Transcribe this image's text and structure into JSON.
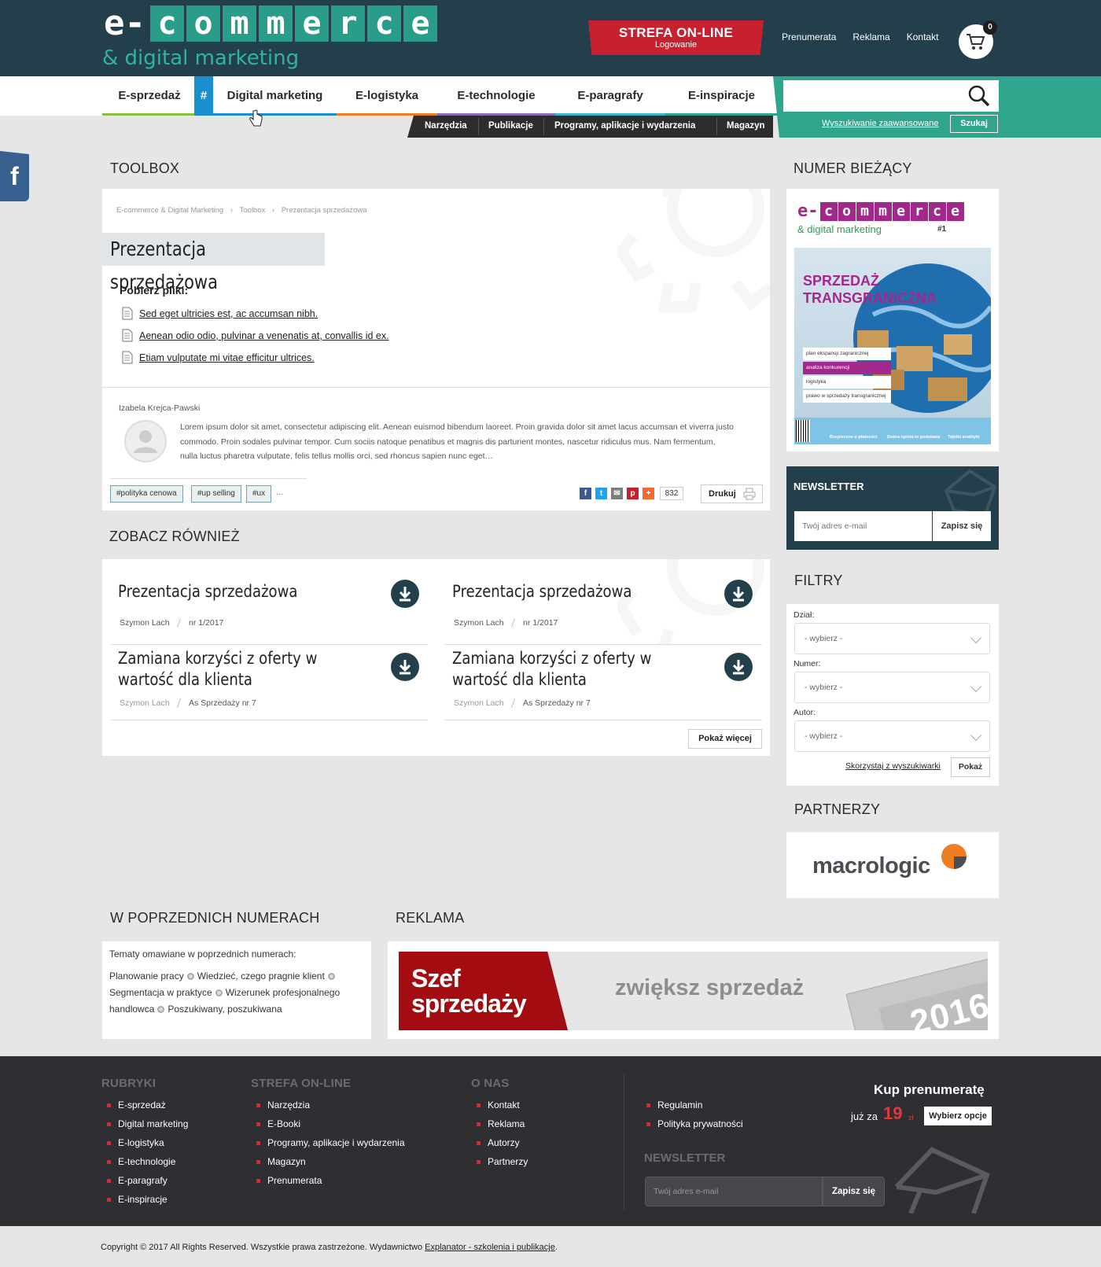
{
  "header": {
    "logo_main_plain": "e-",
    "logo_main_tiles": [
      "c",
      "o",
      "m",
      "m",
      "e",
      "r",
      "c",
      "e"
    ],
    "logo_sub": "& digital marketing",
    "strefa_title": "STREFA ON-LINE",
    "strefa_sub": "Logowanie",
    "links": [
      "Prenumerata",
      "Reklama",
      "Kontakt"
    ],
    "cart_count": "0"
  },
  "nav": {
    "items": [
      {
        "label": "E-sprzedaż",
        "color": "#8cbf3f"
      },
      {
        "label": "Digital marketing",
        "color": "#1a8fcf"
      },
      {
        "label": "E-logistyka",
        "color": "#ef7d22"
      },
      {
        "label": "E-technologie",
        "color": "#8b6bb1"
      },
      {
        "label": "E-paragrafy",
        "color": "#3db7c6"
      },
      {
        "label": "E-inspiracje",
        "color": "#2fa58e"
      }
    ],
    "hash": "#",
    "sub": [
      "Narzędzia",
      "Publikacje",
      "Programy, aplikacje i wydarzenia",
      "Magazyn"
    ]
  },
  "search": {
    "placeholder": "",
    "advanced": "Wyszukiwanie zaawansowane",
    "button": "Szukaj"
  },
  "social_tab": "f",
  "toolbox": {
    "section_title": "TOOLBOX",
    "breadcrumb": [
      "E-commerce & Digital Marketing",
      "›",
      "Toolbox",
      "›",
      "Prezentacja sprzedażowa"
    ],
    "title": "Prezentacja sprzedażowa",
    "download_heading": "Pobierz pliki:",
    "files": [
      "Sed eget ultricies est, ac accumsan nibh.",
      "Aenean odio odio, pulvinar a venenatis at, convallis id ex.",
      "Etiam vulputate mi vitae efficitur ultrices."
    ],
    "author": "Izabela Krejca-Pawski",
    "bio": "Lorem ipsum dolor sit amet, consectetur adipiscing elit. Aenean euismod bibendum laoreet. Proin gravida dolor sit amet lacus accumsan et viverra justo commodo. Proin sodales pulvinar tempor. Cum sociis natoque penatibus et magnis dis parturient montes, nascetur ridiculus mus. Nam fermentum, nulla luctus pharetra vulputate, felis tellus mollis orci, sed rhoncus sapien nunc eget…",
    "tags": [
      "#polityka cenowa",
      "#up selling",
      "#ux"
    ],
    "tags_more": "...",
    "share_count": "832",
    "print": "Drukuj"
  },
  "see_also": {
    "section_title": "ZOBACZ RÓWNIEŻ",
    "items": [
      {
        "title": "Prezentacja sprzedażowa",
        "author": "Szymon Lach",
        "issue": "nr 1/2017"
      },
      {
        "title": "Prezentacja sprzedażowa",
        "author": "Szymon Lach",
        "issue": "nr 1/2017"
      },
      {
        "title": "Zamiana korzyści z oferty w wartość dla klienta",
        "author": "Szymon Lach",
        "issue": "As Sprzedaży nr 7"
      },
      {
        "title": "Zamiana korzyści z oferty w wartość dla klienta",
        "author": "Szymon Lach",
        "issue": "As Sprzedaży nr 7"
      }
    ],
    "more": "Pokaż więcej"
  },
  "sidebar": {
    "current_title": "NUMER BIEŻĄCY",
    "cover": {
      "logo_plain": "e-",
      "logo_tiles": [
        "c",
        "o",
        "m",
        "m",
        "e",
        "r",
        "c",
        "e"
      ],
      "logo_sub": "& digital marketing",
      "issue": "#1",
      "headline1": "SPRZEDAŻ",
      "headline2": "TRANSGRANICZNA",
      "menu": [
        "plan ekspansji zagranicznej",
        "analiza konkurencji",
        "logistyka",
        "prawo w sprzedaży transgranicznej"
      ],
      "bottom": [
        "Bezpieczne e-płatności",
        "Dobra opinia to podstawa",
        "Tajniki analityki"
      ]
    },
    "newsletter_title": "NEWSLETTER",
    "newsletter_placeholder": "Twój adres e-mail",
    "newsletter_button": "Zapisz się",
    "filters_title": "FILTRY",
    "filters": [
      {
        "label": "Dział:",
        "value": "- wybierz -"
      },
      {
        "label": "Numer:",
        "value": "- wybierz -"
      },
      {
        "label": "Autor:",
        "value": "- wybierz -"
      }
    ],
    "filters_link": "Skorzystaj z wyszukiwarki",
    "filters_button": "Pokaż",
    "partners_title": "PARTNERZY",
    "partner_name": "macrologic"
  },
  "previous": {
    "section_title": "W POPRZEDNICH NUMERACH",
    "intro": "Tematy omawiane w poprzednich numerach:",
    "topics": [
      "Planowanie pracy",
      "Wiedzieć, czego pragnie klient",
      "Segmentacja w praktyce",
      "Wizerunek profesjonalnego handlowca",
      "Poszukiwany, poszukiwana"
    ]
  },
  "ad": {
    "section_title": "REKLAMA",
    "brand1": "Szef",
    "brand2": "sprzedaży",
    "slogan": "zwiększ sprzedaż",
    "year": "2016"
  },
  "footer": {
    "rubryki_title": "RUBRYKI",
    "rubryki": [
      "E-sprzedaż",
      "Digital marketing",
      "E-logistyka",
      "E-technologie",
      "E-paragrafy",
      "E-inspiracje"
    ],
    "strefa_title": "STREFA ON-LINE",
    "strefa": [
      "Narzędzia",
      "E-Booki",
      "Programy, aplikacje i wydarzenia",
      "Magazyn",
      "Prenumerata"
    ],
    "onas_title": "O NAS",
    "onas": [
      "Kontakt",
      "Reklama",
      "Autorzy",
      "Partnerzy"
    ],
    "legal": [
      "Regulamin",
      "Polityka prywatności"
    ],
    "kup": "Kup prenumeratę",
    "juz_za": "już za",
    "price": "19",
    "currency": "zł",
    "wybierz": "Wybierz opcje",
    "newsletter_title": "NEWSLETTER",
    "newsletter_placeholder": "Twój adres e-mail",
    "newsletter_button": "Zapisz się"
  },
  "copyright": {
    "text": "Copyright © 2017 All Rights Reserved. Wszystkie prawa zastrzeżone. Wydawnictwo ",
    "link": "Explanator - szkolenia i publikacje",
    "end": "."
  },
  "colors": {
    "dark": "#233f4c",
    "teal": "#2fa58e",
    "red": "#c8202f",
    "footer": "#2e2e33"
  }
}
